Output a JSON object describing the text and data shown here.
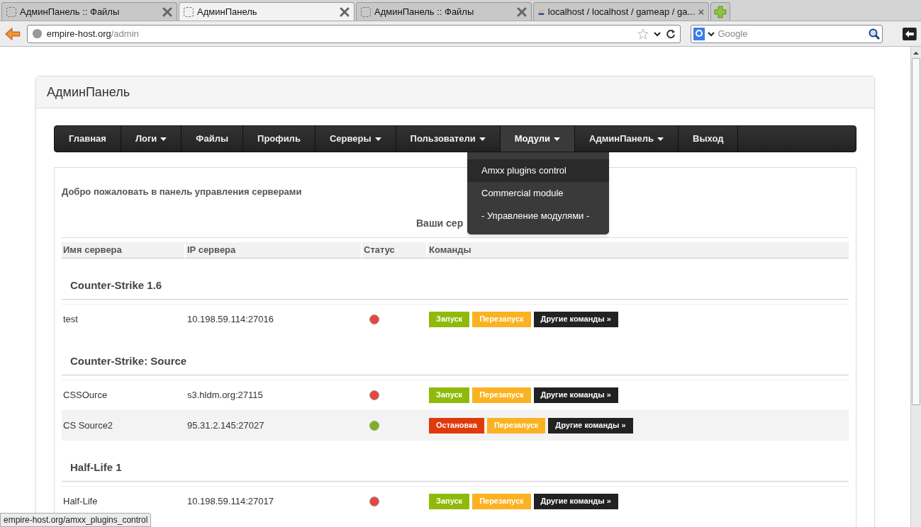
{
  "browser": {
    "tabs": [
      {
        "label": "АдминПанель :: Файлы",
        "selected": false,
        "kind": "blank"
      },
      {
        "label": "АдминПанель",
        "selected": true,
        "kind": "blank"
      },
      {
        "label": "АдминПанель :: Файлы",
        "selected": false,
        "kind": "blank"
      },
      {
        "label": "localhost / localhost / gameap / ga...",
        "selected": false,
        "kind": "logo"
      }
    ],
    "url": {
      "host": "empire-host.org",
      "path": "/admin"
    },
    "search": {
      "placeholder": "Google"
    },
    "status_bar": "empire-host.org/amxx_plugins_control"
  },
  "panel": {
    "title": "АдминПанель",
    "nav": [
      {
        "label": "Главная",
        "caret": false,
        "selected": false
      },
      {
        "label": "Логи",
        "caret": true,
        "selected": false
      },
      {
        "label": "Файлы",
        "caret": false,
        "selected": false
      },
      {
        "label": "Профиль",
        "caret": false,
        "selected": false
      },
      {
        "label": "Серверы",
        "caret": true,
        "selected": false
      },
      {
        "label": "Пользователи",
        "caret": true,
        "selected": false
      },
      {
        "label": "Модули",
        "caret": true,
        "selected": true
      },
      {
        "label": "АдминПанель",
        "caret": true,
        "selected": false
      },
      {
        "label": "Выход",
        "caret": false,
        "selected": false
      }
    ],
    "dropdown": [
      {
        "label": "Amxx plugins control",
        "selected": true
      },
      {
        "label": "Commercial module",
        "selected": false
      },
      {
        "label": "- Управление модулями -",
        "selected": false
      }
    ],
    "welcome": "Добро пожаловать в панель управления серверами",
    "table_title": "Ваши сер",
    "columns": [
      "Имя сервера",
      "IP сервера",
      "Статус",
      "Команды"
    ],
    "rows": [
      {
        "kind": "group",
        "title": "Counter-Strike 1.6"
      },
      {
        "kind": "server",
        "name": "test",
        "ip": "10.198.59.114:27016",
        "color": "#e8453c",
        "striped": false,
        "commands": [
          {
            "kind": "start",
            "label": "Запуск"
          },
          {
            "kind": "restart",
            "label": "Перезапуск"
          },
          {
            "kind": "more",
            "label": "Другие команды »"
          }
        ]
      },
      {
        "kind": "group",
        "title": "Counter-Strike: Source"
      },
      {
        "kind": "server",
        "name": "CSSOurce",
        "ip": "s3.hldm.org:27115",
        "color": "#e8453c",
        "striped": false,
        "commands": [
          {
            "kind": "start",
            "label": "Запуск"
          },
          {
            "kind": "restart",
            "label": "Перезапуск"
          },
          {
            "kind": "more",
            "label": "Другие команды »"
          }
        ]
      },
      {
        "kind": "server",
        "name": "CS Source2",
        "ip": "95.31.2.145:27027",
        "color": "#7cb518",
        "striped": true,
        "commands": [
          {
            "kind": "stop",
            "label": "Остановка"
          },
          {
            "kind": "restart",
            "label": "Перезапуск"
          },
          {
            "kind": "more",
            "label": "Другие команды »"
          }
        ]
      },
      {
        "kind": "group",
        "title": "Half-Life 1"
      },
      {
        "kind": "server",
        "name": "Half-Life",
        "ip": "10.198.59.114:27017",
        "color": "#e8453c",
        "striped": false,
        "commands": [
          {
            "kind": "start",
            "label": "Запуск"
          },
          {
            "kind": "restart",
            "label": "Перезапуск"
          },
          {
            "kind": "more",
            "label": "Другие команды »"
          }
        ]
      }
    ]
  }
}
